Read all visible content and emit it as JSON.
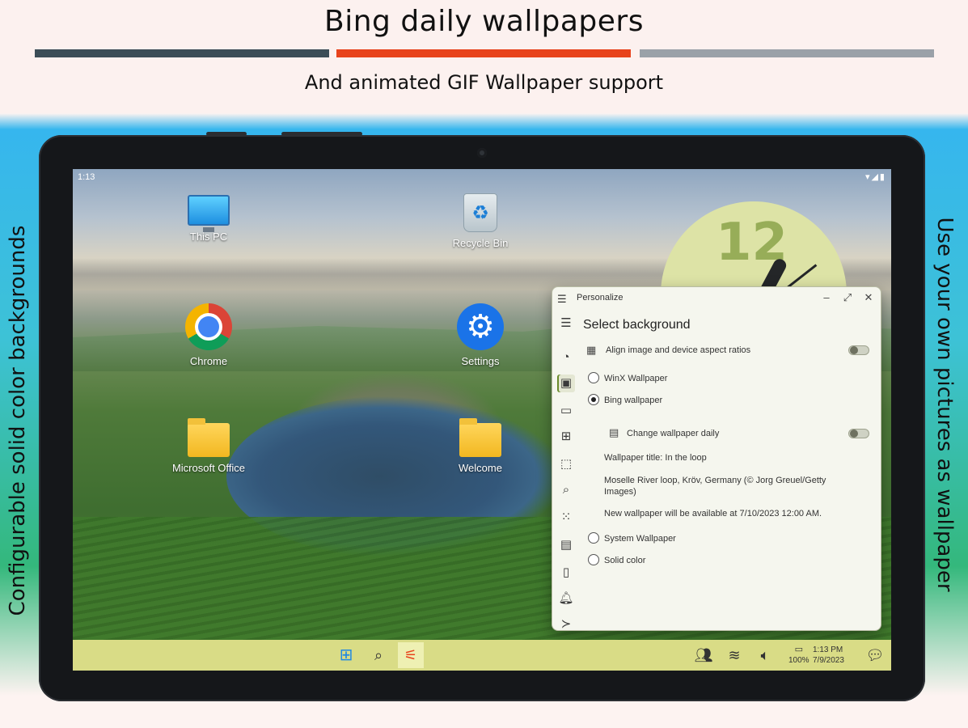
{
  "promo": {
    "headline": "Bing daily wallpapers",
    "subheadline": "And animated GIF Wallpaper support",
    "left_caption": "Configurable solid color backgrounds",
    "right_caption": "Use your own pictures as wallpaper"
  },
  "status_bar": {
    "time": "1:13",
    "right_icons": "▾◢▮"
  },
  "desktop": {
    "icons": [
      {
        "label": "This PC"
      },
      {
        "label": "Recycle Bin"
      },
      {
        "label": "Chrome"
      },
      {
        "label": "Settings"
      },
      {
        "label": "Microsoft Office"
      },
      {
        "label": "Welcome"
      }
    ]
  },
  "clock_widget": {
    "face_number": "12"
  },
  "window": {
    "title": "Personalize",
    "heading": "Select background",
    "align_label": "Align image and device aspect ratios",
    "align_on": false,
    "options": {
      "winx": "WinX Wallpaper",
      "bing": "Bing wallpaper",
      "system": "System Wallpaper",
      "solid": "Solid color"
    },
    "selected_option": "bing",
    "change_daily_label": "Change wallpaper daily",
    "change_daily_on": false,
    "wallpaper_title": "Wallpaper title: In the loop",
    "wallpaper_desc": "Moselle River loop, Kröv, Germany (© Jorg Greuel/Getty Images)",
    "next_wallpaper": "New wallpaper will be available at 7/10/2023 12:00 AM."
  },
  "taskbar": {
    "battery": "100%",
    "time": "1:13 PM",
    "date": "7/9/2023"
  },
  "colors": {
    "headline_bar_left": "#3b4d57",
    "headline_bar_mid": "#e8431c",
    "headline_bar_right": "#9aa1a8",
    "taskbar": "#d9dc86",
    "window_bg": "#f5f6ee"
  }
}
